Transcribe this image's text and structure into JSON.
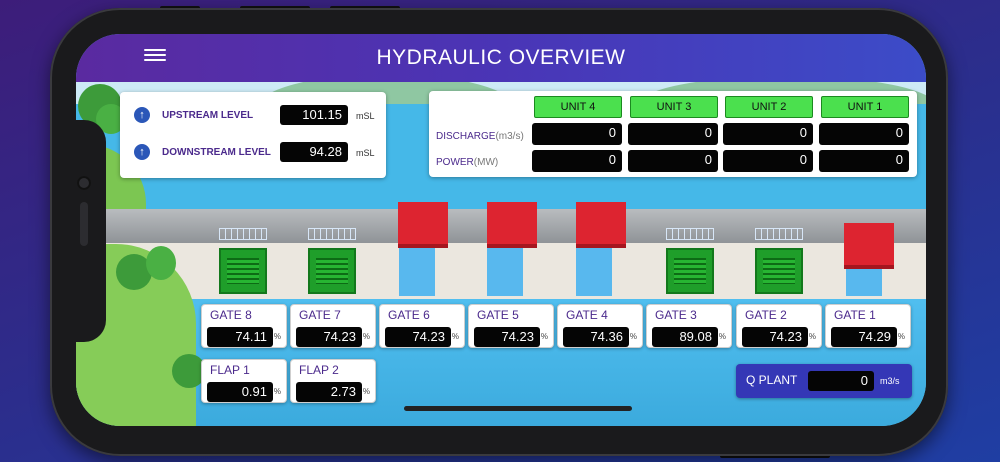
{
  "app": {
    "title": "HYDRAULIC OVERVIEW"
  },
  "levels": {
    "upstream": {
      "label": "UPSTREAM LEVEL",
      "value": "101.15",
      "unit": "mSL"
    },
    "downstream": {
      "label": "DOWNSTREAM LEVEL",
      "value": "94.28",
      "unit": "mSL"
    }
  },
  "units": {
    "headers": [
      "UNIT 4",
      "UNIT 3",
      "UNIT 2",
      "UNIT 1"
    ],
    "discharge": {
      "label": "DISCHARGE",
      "unit": "(m3/s)",
      "values": [
        "0",
        "0",
        "0",
        "0"
      ]
    },
    "power": {
      "label": "POWER",
      "unit": "(MW)",
      "values": [
        "0",
        "0",
        "0",
        "0"
      ]
    }
  },
  "gates": [
    {
      "name": "GATE 8",
      "value": "74.11",
      "unit": "%"
    },
    {
      "name": "GATE 7",
      "value": "74.23",
      "unit": "%"
    },
    {
      "name": "GATE 6",
      "value": "74.23",
      "unit": "%"
    },
    {
      "name": "GATE 5",
      "value": "74.23",
      "unit": "%"
    },
    {
      "name": "GATE 4",
      "value": "74.36",
      "unit": "%"
    },
    {
      "name": "GATE 3",
      "value": "89.08",
      "unit": "%"
    },
    {
      "name": "GATE 2",
      "value": "74.23",
      "unit": "%"
    },
    {
      "name": "GATE 1",
      "value": "74.29",
      "unit": "%"
    }
  ],
  "flaps": [
    {
      "name": "FLAP 1",
      "value": "0.91",
      "unit": "%"
    },
    {
      "name": "FLAP 2",
      "value": "2.73",
      "unit": "%"
    }
  ],
  "qplant": {
    "label": "Q PLANT",
    "value": "0",
    "unit": "m3/s"
  },
  "colors": {
    "accent": "#4a35b6",
    "unit_header": "#4be04e",
    "gate_open": "#1f9e2a",
    "gate_closed": "#dd2430"
  },
  "icons": {
    "menu": "hamburger-menu-icon",
    "level_arrow": "arrow-up-icon"
  }
}
